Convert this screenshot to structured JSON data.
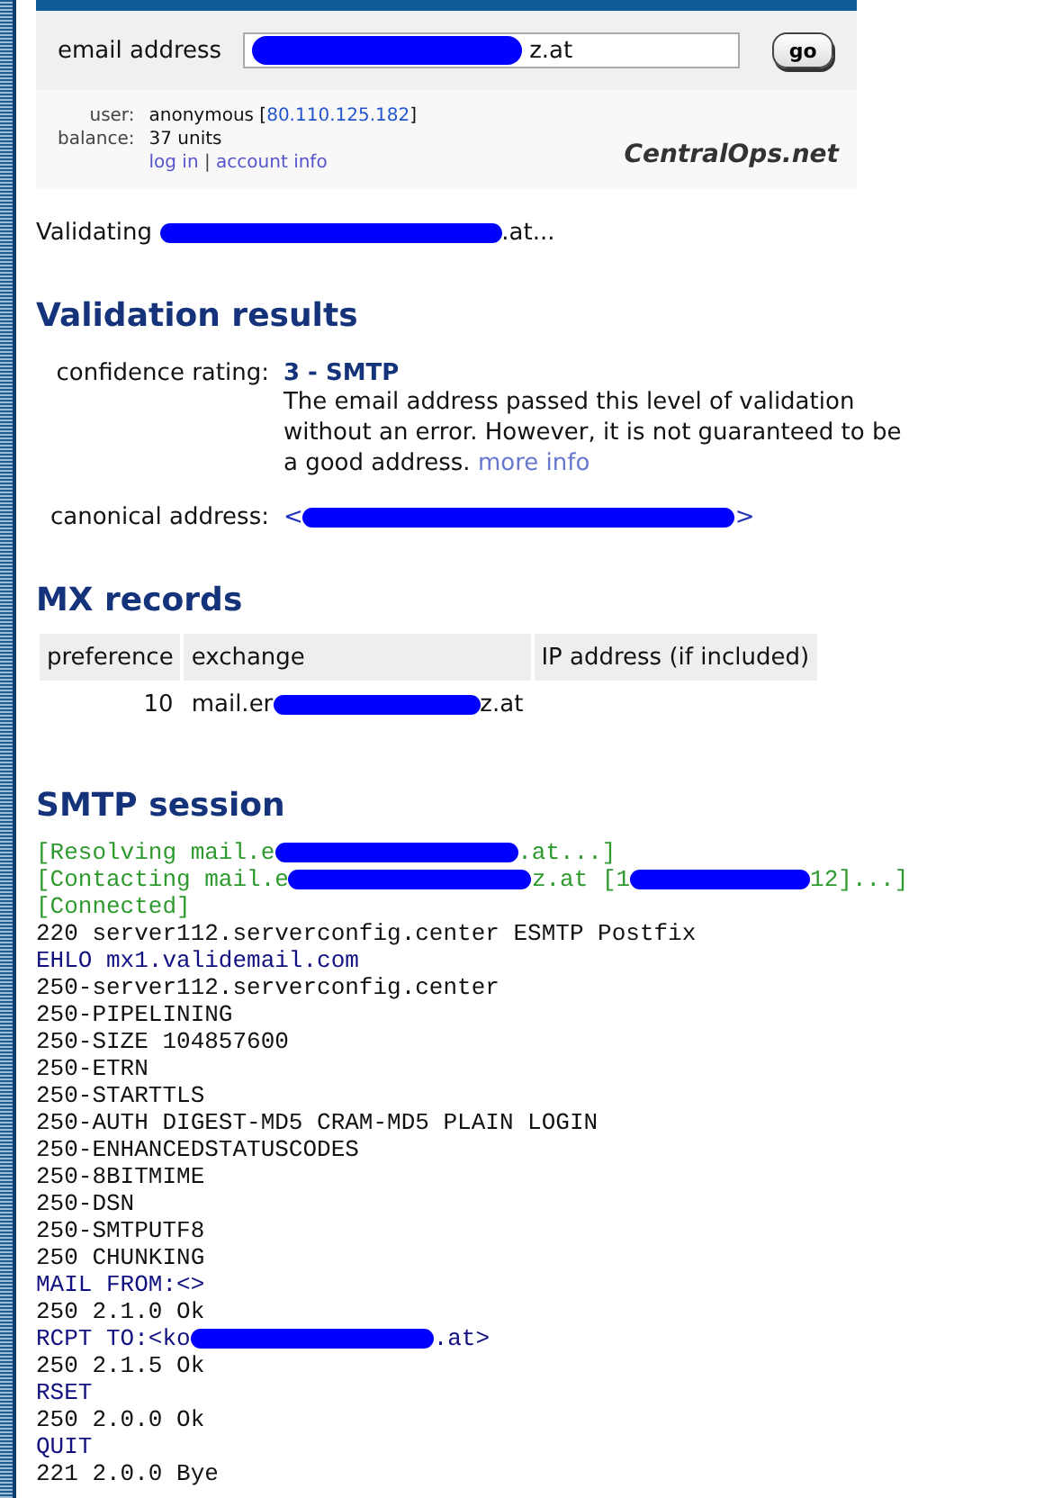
{
  "search": {
    "label": "email address",
    "value": "z.at",
    "button": "go"
  },
  "account": {
    "rows": [
      {
        "label": "user:",
        "value_before": "anonymous [",
        "link": "80.110.125.182",
        "value_after": "]"
      },
      {
        "label": "balance:",
        "value_before": "37 units"
      }
    ],
    "links": [
      "log in",
      "account info"
    ],
    "separator": "|",
    "logo": "CentralOps.net"
  },
  "status": [
    "Validating ",
    ".at..."
  ],
  "validation": {
    "title": "Validation results",
    "confidence_label": "confidence rating:",
    "confidence_value": "3 - SMTP",
    "description": "The email address passed this level of validation without an error. However, it is not guaranteed to be a good address. ",
    "more_link": "more info",
    "canonical_label": "canonical address:",
    "canonical_value": [
      "<",
      ">"
    ]
  },
  "mx": {
    "title": "MX records",
    "columns": [
      "preference",
      "exchange",
      "IP address (if included)"
    ],
    "rows": [
      {
        "preference": "10",
        "exchange": [
          "mail.er",
          "z.at"
        ]
      }
    ]
  },
  "smtp": {
    "title": "SMTP session",
    "lines": [
      {
        "kind": "status",
        "parts": [
          "[Resolving mail.e",
          ".at...]"
        ]
      },
      {
        "kind": "status",
        "parts": [
          "[Contacting mail.e",
          "z.at [1",
          "12]...]"
        ]
      },
      {
        "kind": "status",
        "parts": [
          "[Connected]"
        ]
      },
      {
        "kind": "server",
        "parts": [
          "220 server112.serverconfig.center ESMTP Postfix"
        ]
      },
      {
        "kind": "client",
        "parts": [
          "EHLO mx1.validemail.com"
        ]
      },
      {
        "kind": "server",
        "parts": [
          "250-server112.serverconfig.center"
        ]
      },
      {
        "kind": "server",
        "parts": [
          "250-PIPELINING"
        ]
      },
      {
        "kind": "server",
        "parts": [
          "250-SIZE 104857600"
        ]
      },
      {
        "kind": "server",
        "parts": [
          "250-ETRN"
        ]
      },
      {
        "kind": "server",
        "parts": [
          "250-STARTTLS"
        ]
      },
      {
        "kind": "server",
        "parts": [
          "250-AUTH DIGEST-MD5 CRAM-MD5 PLAIN LOGIN"
        ]
      },
      {
        "kind": "server",
        "parts": [
          "250-ENHANCEDSTATUSCODES"
        ]
      },
      {
        "kind": "server",
        "parts": [
          "250-8BITMIME"
        ]
      },
      {
        "kind": "server",
        "parts": [
          "250-DSN"
        ]
      },
      {
        "kind": "server",
        "parts": [
          "250-SMTPUTF8"
        ]
      },
      {
        "kind": "server",
        "parts": [
          "250 CHUNKING"
        ]
      },
      {
        "kind": "client",
        "parts": [
          "MAIL FROM:<>"
        ]
      },
      {
        "kind": "server",
        "parts": [
          "250 2.1.0 Ok"
        ]
      },
      {
        "kind": "client",
        "parts": [
          "RCPT TO:<ko",
          ".at>"
        ]
      },
      {
        "kind": "server",
        "parts": [
          "250 2.1.5 Ok"
        ]
      },
      {
        "kind": "client",
        "parts": [
          "RSET"
        ]
      },
      {
        "kind": "server",
        "parts": [
          "250 2.0.0 Ok"
        ]
      },
      {
        "kind": "client",
        "parts": [
          "QUIT"
        ]
      },
      {
        "kind": "server",
        "parts": [
          "221 2.0.0 Bye"
        ]
      }
    ]
  }
}
